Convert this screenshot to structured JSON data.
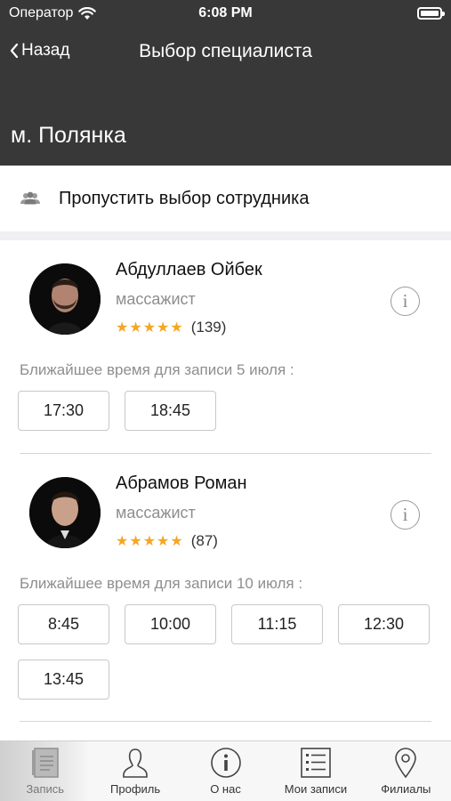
{
  "status_bar": {
    "carrier": "Оператор",
    "time": "6:08 PM"
  },
  "nav": {
    "back_label": "Назад",
    "title": "Выбор специалиста"
  },
  "branch": {
    "name": "м. Полянка"
  },
  "skip": {
    "label": "Пропустить выбор сотрудника",
    "icon": "people-icon"
  },
  "specialists": [
    {
      "name": "Абдуллаев Ойбек",
      "role": "массажист",
      "stars": "★★★★★",
      "reviews": "(139)",
      "nearest": "Ближайшее время для записи 5 июля :",
      "slots": [
        "17:30",
        "18:45"
      ]
    },
    {
      "name": "Абрамов Роман",
      "role": "массажист",
      "stars": "★★★★★",
      "reviews": "(87)",
      "nearest": "Ближайшее время для записи 10 июля :",
      "slots": [
        "8:45",
        "10:00",
        "11:15",
        "12:30",
        "13:45"
      ]
    }
  ],
  "tabbar": {
    "items": [
      {
        "label": "Запись",
        "icon": "journal-icon",
        "active": true
      },
      {
        "label": "Профиль",
        "icon": "person-icon",
        "active": false
      },
      {
        "label": "О нас",
        "icon": "info-icon",
        "active": false
      },
      {
        "label": "Мои записи",
        "icon": "list-icon",
        "active": false
      },
      {
        "label": "Филиалы",
        "icon": "location-pin-icon",
        "active": false
      }
    ]
  },
  "colors": {
    "header_bg": "#383838",
    "star": "#f5a623",
    "muted_text": "#8e8e8e"
  }
}
